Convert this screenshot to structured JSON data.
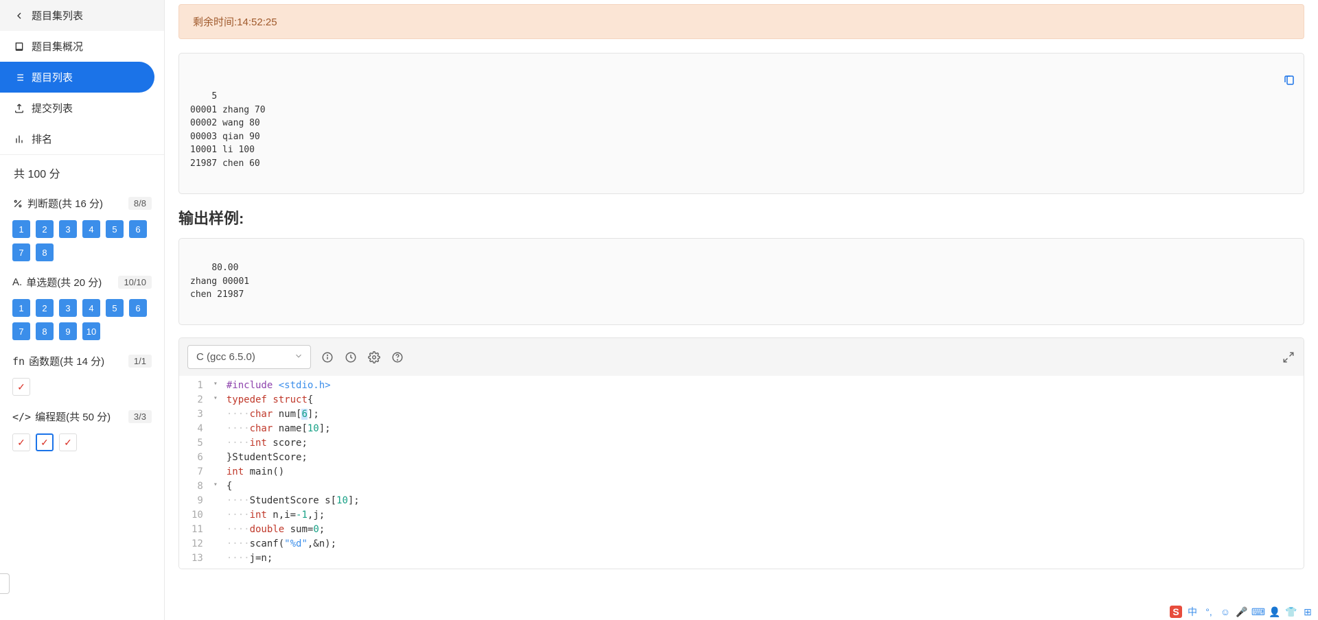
{
  "sidebar": {
    "back": "题目集列表",
    "overview": "题目集概况",
    "list": "题目列表",
    "submissions": "提交列表",
    "ranking": "排名"
  },
  "score_header": "共 100 分",
  "sections": {
    "judge": {
      "title": "判断题(共 16 分)",
      "badge": "8/8",
      "nums": [
        "1",
        "2",
        "3",
        "4",
        "5",
        "6",
        "7",
        "8"
      ]
    },
    "single": {
      "title": "单选题(共 20 分)",
      "badge": "10/10",
      "nums": [
        "1",
        "2",
        "3",
        "4",
        "5",
        "6",
        "7",
        "8",
        "9",
        "10"
      ]
    },
    "func": {
      "title": "函数题(共 14 分)",
      "badge": "1/1",
      "checks": 1
    },
    "prog": {
      "title": "编程题(共 50 分)",
      "badge": "3/3",
      "checks": 3
    }
  },
  "timer": "剩余时间:14:52:25",
  "input_sample": "5\n00001 zhang 70\n00002 wang 80\n00003 qian 90\n10001 li 100\n21987 chen 60",
  "output_heading": "输出样例:",
  "output_sample": "80.00\nzhang 00001\nchen 21987",
  "language": "C (gcc 6.5.0)",
  "code": {
    "l1_a": "#include",
    "l1_b": " <stdio.h>",
    "l2_a": "typedef",
    "l2_b": "struct",
    "l2_c": "{",
    "l3_a": "char",
    "l3_b": " num[",
    "l3_c": "6",
    "l3_d": "];",
    "l4_a": "char",
    "l4_b": " name[",
    "l4_c": "10",
    "l4_d": "];",
    "l5_a": "int",
    "l5_b": " score;",
    "l6": "}StudentScore;",
    "l7_a": "int",
    "l7_b": " main()",
    "l8": "{",
    "l9_a": "StudentScore s[",
    "l9_b": "10",
    "l9_c": "];",
    "l10_a": "int",
    "l10_b": " n,i=",
    "l10_c": "-1",
    "l10_d": ",j;",
    "l11_a": "double",
    "l11_b": " sum=",
    "l11_c": "0",
    "l11_d": ";",
    "l12_a": "scanf(",
    "l12_b": "\"%d\"",
    "l12_c": ",&n);",
    "l13": "j=n;"
  },
  "line_numbers": [
    "1",
    "2",
    "3",
    "4",
    "5",
    "6",
    "7",
    "8",
    "9",
    "10",
    "11",
    "12",
    "13"
  ],
  "ime": "中"
}
